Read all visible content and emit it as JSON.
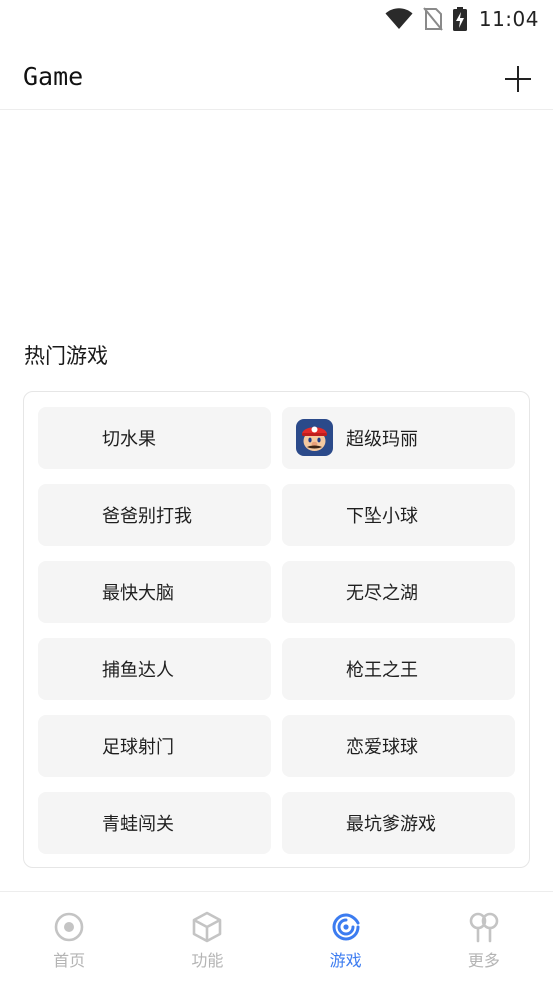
{
  "status_bar": {
    "time": "11:04",
    "icons": [
      "wifi-icon",
      "no-sim-icon",
      "battery-charging-icon"
    ]
  },
  "header": {
    "title": "Game",
    "add_icon": "plus-icon"
  },
  "section": {
    "title": "热门游戏"
  },
  "games": [
    {
      "label": "切水果",
      "icon": null
    },
    {
      "label": "超级玛丽",
      "icon": "mario-icon"
    },
    {
      "label": "爸爸别打我",
      "icon": null
    },
    {
      "label": "下坠小球",
      "icon": null
    },
    {
      "label": "最快大脑",
      "icon": null
    },
    {
      "label": "无尽之湖",
      "icon": null
    },
    {
      "label": "捕鱼达人",
      "icon": null
    },
    {
      "label": "枪王之王",
      "icon": null
    },
    {
      "label": "足球射门",
      "icon": null
    },
    {
      "label": "恋爱球球",
      "icon": null
    },
    {
      "label": "青蛙闯关",
      "icon": null
    },
    {
      "label": "最坑爹游戏",
      "icon": null
    }
  ],
  "nav": {
    "items": [
      {
        "label": "首页",
        "icon": "home-circle-icon",
        "active": false
      },
      {
        "label": "功能",
        "icon": "cube-icon",
        "active": false
      },
      {
        "label": "游戏",
        "icon": "game-swirl-icon",
        "active": true
      },
      {
        "label": "更多",
        "icon": "more-icon",
        "active": false
      }
    ]
  },
  "colors": {
    "accent": "#3c7cf0",
    "inactive": "#b4b4b4",
    "tile_background": "#f5f5f5"
  }
}
